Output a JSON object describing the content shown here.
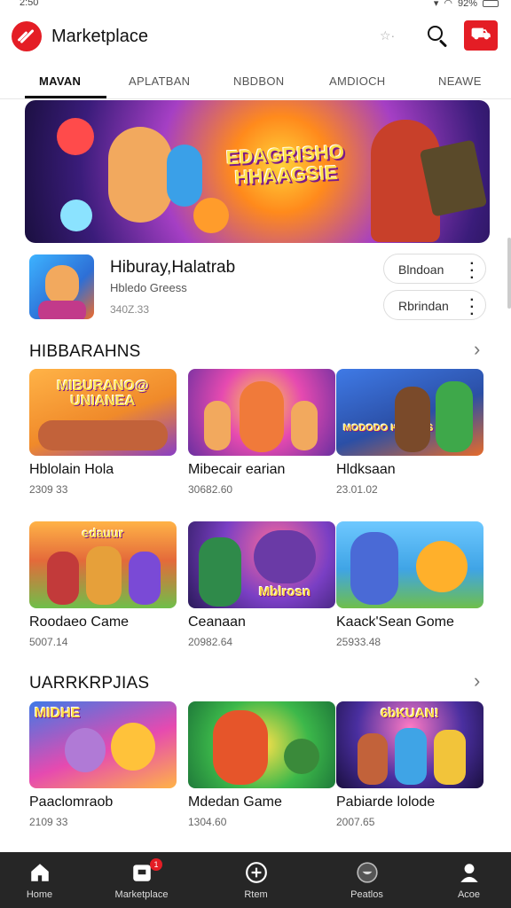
{
  "status": {
    "time": "2:50",
    "battery": "92%"
  },
  "header": {
    "title": "Marketplace",
    "mini": "☆·"
  },
  "tabs": [
    {
      "label": "MAVAN",
      "active": true
    },
    {
      "label": "APLATBAN",
      "active": false
    },
    {
      "label": "NBDBON",
      "active": false
    },
    {
      "label": "AMDIOCH",
      "active": false
    },
    {
      "label": "NEAWE",
      "active": false
    }
  ],
  "banner": {
    "title": "EDAGRISHO HHAAGSIE"
  },
  "featured": {
    "title": "Hiburay,Halatrab",
    "subtitle": "Hbledo Greess",
    "size": "340Z.33",
    "btn1": "Blndoan",
    "btn2": "Rbrindan"
  },
  "section1": {
    "title": "HIBBARAHNS",
    "cards": [
      {
        "name": "Hblolain Hola",
        "meta": "2309 33",
        "thumb": "MIBURANO@ UNIANEA",
        "bg": "#f08a2a"
      },
      {
        "name": "Mibecair earian",
        "meta": "30682.60",
        "thumb": "",
        "bg": "#c24bd6"
      },
      {
        "name": "Hldksaan",
        "meta": "23.01.02",
        "thumb": "MODODO KANUOS",
        "bg": "#2b6fd6"
      },
      {
        "name": "Roodaeo Came",
        "meta": "5007.14",
        "thumb": "edauur",
        "bg": "#6fbf4a"
      },
      {
        "name": "Ceanaan",
        "meta": "20982.64",
        "thumb": "Mblrosn",
        "bg": "#7a3fc4"
      },
      {
        "name": "Kaack'Sean Gome",
        "meta": "25933.48",
        "thumb": "",
        "bg": "#3fa4e6"
      }
    ]
  },
  "section2": {
    "title": "UARRKRPJIAS",
    "cards": [
      {
        "name": "Paaclomraob",
        "meta": "2109 33",
        "thumb": "MIDHE",
        "bg": "#e64ab0"
      },
      {
        "name": "Mdedan Game",
        "meta": "1304.60",
        "thumb": "",
        "bg": "#3cb84a"
      },
      {
        "name": "Pabiarde lolode",
        "meta": "2007.65",
        "thumb": "6bKUAN!",
        "bg": "#4a2fa0"
      }
    ]
  },
  "nav": [
    {
      "label": "Home",
      "icon": "home-icon"
    },
    {
      "label": "Marketplace",
      "icon": "store-icon"
    },
    {
      "label": "Rtem",
      "icon": "plus-circle-icon"
    },
    {
      "label": "Peatlos",
      "icon": "bowl-icon"
    },
    {
      "label": "Acoe",
      "icon": "person-icon"
    }
  ],
  "nav_badge": "1",
  "colors": {
    "accent": "#e41d25",
    "navbar": "#262626"
  }
}
